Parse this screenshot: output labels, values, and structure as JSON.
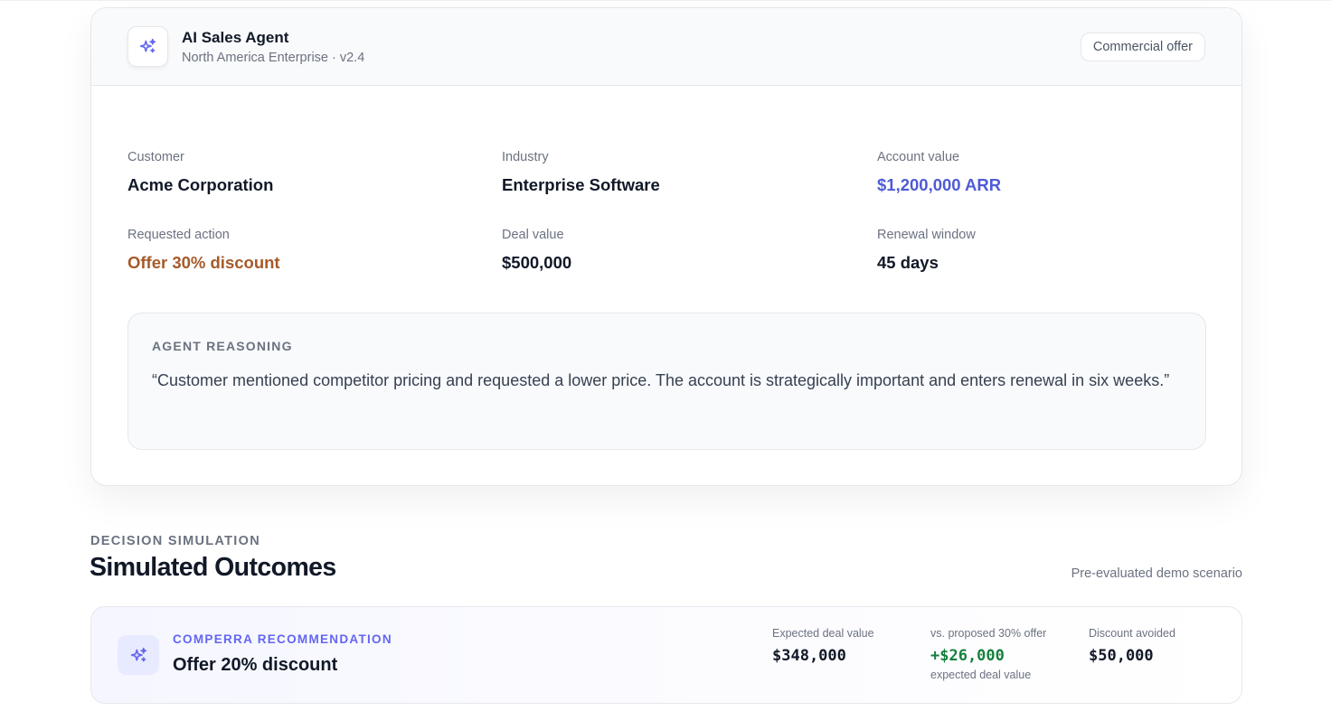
{
  "agent": {
    "title": "AI Sales Agent",
    "subtitle": "North America Enterprise · v2.4",
    "badge": "Commercial offer",
    "icon": "sparkles-icon"
  },
  "fields": {
    "customer": {
      "label": "Customer",
      "value": "Acme Corporation"
    },
    "industry": {
      "label": "Industry",
      "value": "Enterprise Software"
    },
    "account_value": {
      "label": "Account value",
      "value": "$1,200,000 ARR"
    },
    "requested_action": {
      "label": "Requested action",
      "value": "Offer 30% discount"
    },
    "deal_value": {
      "label": "Deal value",
      "value": "$500,000"
    },
    "renewal_window": {
      "label": "Renewal window",
      "value": "45 days"
    }
  },
  "reasoning": {
    "label": "AGENT REASONING",
    "text": "“Customer mentioned competitor pricing and requested a lower price. The account is strategically important and enters renewal in six weeks.”"
  },
  "simulation": {
    "eyebrow": "DECISION SIMULATION",
    "title": "Simulated Outcomes",
    "note": "Pre-evaluated demo scenario"
  },
  "recommendation": {
    "label": "COMPERRA RECOMMENDATION",
    "title": "Offer 20% discount",
    "icon": "sparkles-icon",
    "metrics": [
      {
        "label": "Expected deal value",
        "value": "$348,000",
        "sub": ""
      },
      {
        "label": "vs. proposed 30% offer",
        "value": "+$26,000",
        "sub": "expected deal value"
      },
      {
        "label": "Discount avoided",
        "value": "$50,000",
        "sub": ""
      }
    ]
  },
  "colors": {
    "accent_indigo": "#6366f1",
    "account_value_blue": "#4f5bd5",
    "requested_action_orange": "#a65a2a",
    "positive_green": "#15803d"
  }
}
